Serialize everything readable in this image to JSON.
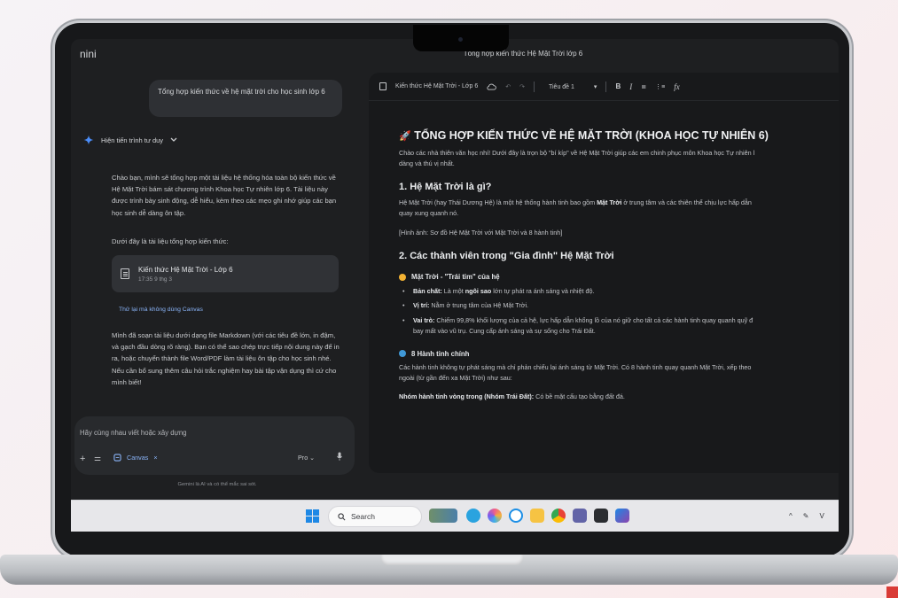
{
  "window": {
    "app_name": "nini",
    "doc_title": "Tổng hợp kiến thức Hệ Mặt Trời lớp 6"
  },
  "chat": {
    "user_message": "Tổng hợp kiến thức về hệ mặt trời cho học sinh lớp 6",
    "thinking_label": "Hiện tiến trình tư duy",
    "intro": "Chào bạn, mình sẽ tổng hợp một tài liệu hệ thống hóa toàn bộ kiến thức về Hệ Mặt Trời bám sát chương trình Khoa học Tự nhiên lớp 6. Tài liệu này được trình bày sinh động, dễ hiểu, kèm theo các mẹo ghi nhớ giúp các bạn học sinh dễ dàng ôn tập.",
    "below_label": "Dưới đây là tài liệu tổng hợp kiến thức:",
    "doc_card": {
      "title": "Kiến thức Hệ Mặt Trời - Lớp 6",
      "time": "17:35 9 thg 3"
    },
    "retry_link": "Thử lại mà không dùng Canvas",
    "outro": "Mình đã soạn tài liệu dưới dạng file Markdown (với các tiêu đề lớn, in đậm, và gạch đầu dòng rõ ràng). Bạn có thể sao chép trực tiếp nội dung này để in ra, hoặc chuyển thành file Word/PDF làm tài liệu ôn tập cho học sinh nhé. Nếu cần bổ sung thêm câu hỏi trắc nghiệm hay bài tập vận dụng thì cứ cho mình biết!"
  },
  "composer": {
    "placeholder": "Hãy cùng nhau viết hoặc xây dựng",
    "canvas_chip": "Canvas",
    "chip_close": "×",
    "model": "Pro",
    "disclaimer": "Gemini là AI và có thể mắc sai sót."
  },
  "toolbar": {
    "doc_name": "Kiến thức Hệ Mặt Trời - Lớp 6",
    "style_select": "Tiêu đề 1",
    "bold": "B",
    "italic": "I",
    "undo": "↶",
    "redo": "↷",
    "bullets": "≣",
    "numbered": "⋮≡",
    "clear": "fx",
    "chevron": "▾"
  },
  "document": {
    "title": "TỔNG HỢP KIẾN THỨC VỀ HỆ MẶT TRỜI (KHOA HỌC TỰ NHIÊN 6)",
    "title_emoji": "🚀",
    "intro_1": "Chào các nhà thiên văn học nhí! Dưới đây là trọn bộ \"bí kíp\" về Hệ Mặt Trời giúp các em chinh phục môn Khoa học Tự nhiên l",
    "intro_2": "dàng và thú vị nhất.",
    "h_section1": "1. Hệ Mặt Trời là gì?",
    "s1_line1_a": "Hệ Mặt Trời (hay Thái Dương Hệ) là một hệ thống hành tinh bao gồm ",
    "s1_line1_b": "Mặt Trời",
    "s1_line1_c": " ở trung tâm và các thiên thể chịu lực hấp dẫn",
    "s1_line2": "quay xung quanh nó.",
    "image_placeholder": "[Hình ảnh: Sơ đồ Hệ Mặt Trời với Mặt Trời và 8 hành tinh]",
    "h_section2": "2. Các thành viên trong \"Gia đình\" Hệ Mặt Trời",
    "h_sun": "Mặt Trời - \"Trái tim\" của hệ",
    "sun_items": [
      {
        "label": "Bản chất:",
        "text_a": " Là một ",
        "bold_mid": "ngôi sao",
        "text_b": " lớn tự phát ra ánh sáng và nhiệt độ."
      },
      {
        "label": "Vị trí:",
        "text_a": " Nằm ở trung tâm của Hệ Mặt Trời.",
        "bold_mid": "",
        "text_b": ""
      },
      {
        "label": "Vai trò:",
        "text_a": " Chiếm 99,8% khối lượng của cả hệ, lực hấp dẫn khổng lồ của nó giữ cho tất cả các hành tinh quay quanh quỹ đ",
        "bold_mid": "",
        "text_b": ""
      }
    ],
    "sun_item3_cont": "bay mất vào vũ trụ. Cung cấp ánh sáng và sự sống cho Trái Đất.",
    "h_planets": "8 Hành tinh chính",
    "planets_line1": "Các hành tinh không tự phát sáng mà chỉ phản chiếu lại ánh sáng từ Mặt Trời. Có 8 hành tinh quay quanh Mặt Trời, xếp theo",
    "planets_line2": "ngoài (từ gần đến xa Mặt Trời) như sau:",
    "inner_label": "Nhóm hành tinh vòng trong (Nhóm Trái Đất):",
    "inner_text": " Có bề mặt cấu tạo bằng đất đá."
  },
  "taskbar": {
    "search_placeholder": "Search",
    "tray_chevron": "^",
    "tray_extra": "V"
  },
  "colors": {
    "accent_blue": "#8ab4f8",
    "windows_blue": "#1e88e5",
    "sun": "#f2b233",
    "planet": "#3f98d6"
  }
}
